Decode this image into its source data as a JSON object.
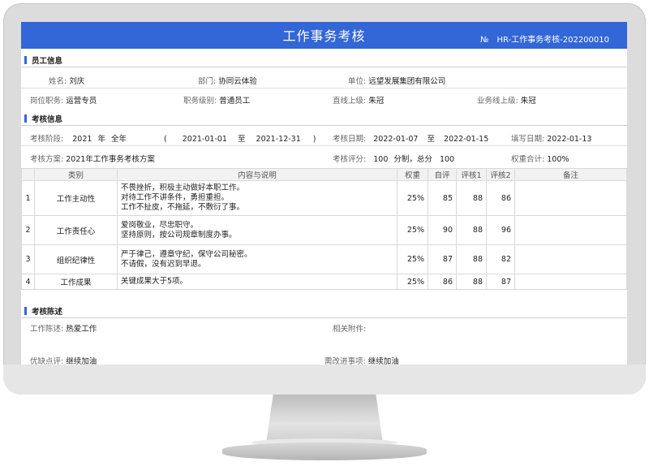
{
  "header": {
    "title": "工作事务考核",
    "doc_no": "№　HR-工作事务考核-202200010"
  },
  "employee_section": {
    "title": "员工信息",
    "name_label": "姓名:",
    "name": "刘庆",
    "dept_label": "部门:",
    "dept": "协同云体验",
    "unit_label": "单位:",
    "unit": "远望发展集团有限公司",
    "post_label": "岗位职务:",
    "post": "运营专员",
    "grade_label": "职务级别:",
    "grade": "普通员工",
    "leader_label": "直线上级:",
    "leader": "朱冠",
    "biz_leader_label": "业务线上级:",
    "biz_leader": "朱冠"
  },
  "assess_section": {
    "title": "考核信息",
    "stage_label": "考核阶段:",
    "stage_year": "2021",
    "stage_year_unit": "年",
    "stage_period": "全年",
    "stage_open": "(",
    "stage_start": "2021-01-01",
    "stage_to": "至",
    "stage_end": "2021-12-31",
    "stage_close": ")",
    "date_label": "考核日期:",
    "date_start": "2022-01-07",
    "date_to": "至",
    "date_end": "2022-01-15",
    "fill_label": "填写日期:",
    "fill_date": "2022-01-13",
    "plan_label": "考核方案:",
    "plan": "2021年工作事务考核方案",
    "score_label": "考核评分:",
    "score_total": "100",
    "score_text": "分制，总分",
    "score_sum": "100",
    "weight_label": "权重合计:",
    "weight_sum": "100%"
  },
  "table": {
    "headers": [
      "",
      "类别",
      "内容与说明",
      "权重",
      "自评",
      "评核1",
      "评核2",
      "备注"
    ],
    "rows": [
      {
        "no": "1",
        "category": "工作主动性",
        "lines": [
          "不畏挫折，积极主动做好本职工作。",
          "对待工作不讲条件，勇担重担。",
          "工作不扯皮，不拖延，不敷衍了事。"
        ],
        "weight": "25%",
        "self": "85",
        "r1": "88",
        "r2": "86",
        "note": ""
      },
      {
        "no": "2",
        "category": "工作责任心",
        "lines": [
          "爱岗敬业，尽忠职守。",
          "坚持原则，按公司规章制度办事。"
        ],
        "weight": "25%",
        "self": "90",
        "r1": "88",
        "r2": "96",
        "note": ""
      },
      {
        "no": "3",
        "category": "组织纪律性",
        "lines": [
          "严于律己，遵章守纪，保守公司秘密。",
          "不请假，没有迟到早退。"
        ],
        "weight": "25%",
        "self": "87",
        "r1": "88",
        "r2": "82",
        "note": ""
      },
      {
        "no": "4",
        "category": "工作成果",
        "lines": [
          "关键成果大于5项。"
        ],
        "weight": "25%",
        "self": "86",
        "r1": "88",
        "r2": "87",
        "note": ""
      }
    ]
  },
  "statement_section": {
    "title": "考核陈述",
    "work_label": "工作陈述:",
    "work": "热爱工作",
    "attach_label": "相关附件:",
    "attach": "",
    "comment_label": "优缺点评:",
    "comment": "继续加油",
    "improve_label": "需改进事项:",
    "improve": "继续加油"
  },
  "colors": {
    "accent": "#3366d6",
    "bezel": "#dcdcdc"
  }
}
